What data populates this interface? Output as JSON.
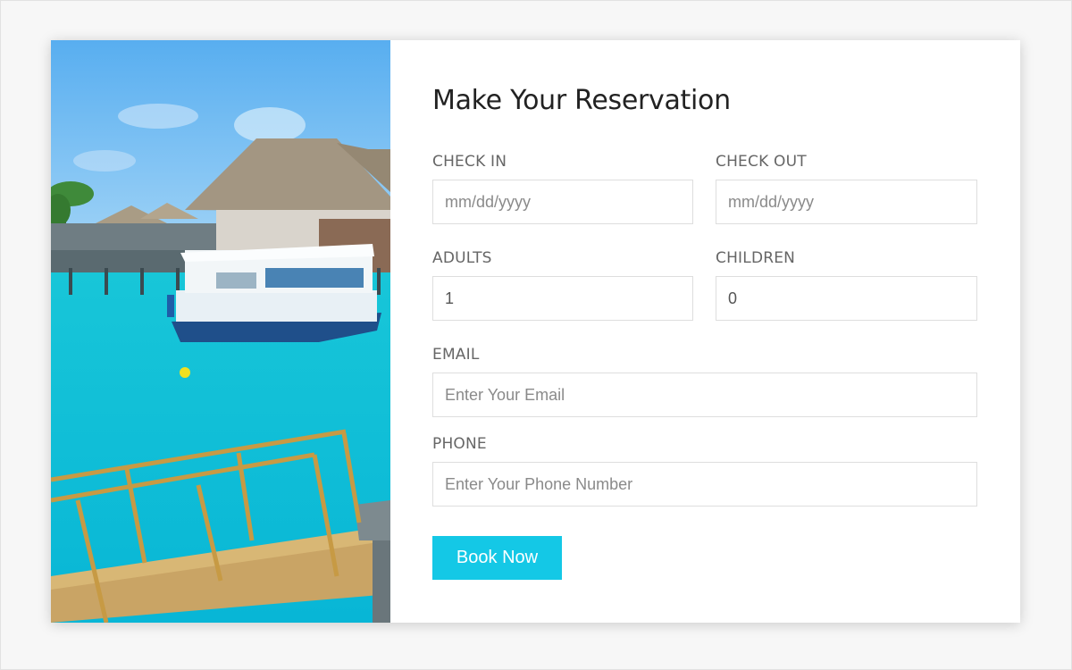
{
  "form": {
    "title": "Make Your Reservation",
    "check_in": {
      "label": "CHECK IN",
      "placeholder": "mm/dd/yyyy",
      "value": ""
    },
    "check_out": {
      "label": "CHECK OUT",
      "placeholder": "mm/dd/yyyy",
      "value": ""
    },
    "adults": {
      "label": "ADULTS",
      "placeholder": "",
      "value": "1"
    },
    "children": {
      "label": "CHILDREN",
      "placeholder": "",
      "value": "0"
    },
    "email": {
      "label": "EMAIL",
      "placeholder": "Enter Your Email",
      "value": ""
    },
    "phone": {
      "label": "PHONE",
      "placeholder": "Enter Your Phone Number",
      "value": ""
    },
    "submit_label": "Book Now"
  },
  "colors": {
    "accent": "#14c8e6",
    "title": "#222222",
    "label": "#666666",
    "input_border": "#dedede"
  }
}
